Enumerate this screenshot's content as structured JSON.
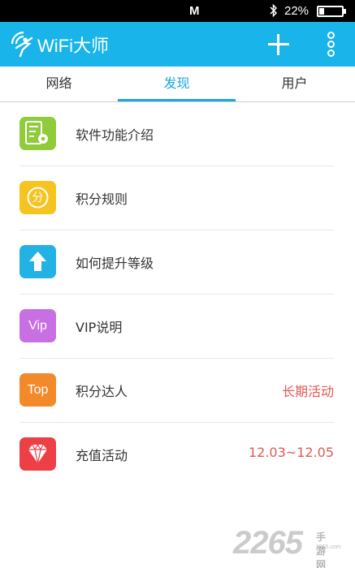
{
  "status_bar": {
    "carrier_icon": "M",
    "bluetooth_icon": "bluetooth-icon",
    "battery_text": "22%",
    "battery_level": 0.22
  },
  "app_bar": {
    "title": "WiFi大师",
    "logo_icon": "wifi-person-logo",
    "add_icon": "plus-icon",
    "more_icon": "more-vertical-icon",
    "background": "#19b4e9"
  },
  "tabs": [
    {
      "label": "网络",
      "active": false
    },
    {
      "label": "发现",
      "active": true
    },
    {
      "label": "用户",
      "active": false
    }
  ],
  "accent_color": "#19a7dc",
  "items": [
    {
      "label": "软件功能介绍",
      "icon": "settings-list-icon",
      "icon_color": "#8fcb3a",
      "icon_text": "",
      "extra": ""
    },
    {
      "label": "积分规则",
      "icon": "points-icon",
      "icon_color": "#f6c321",
      "icon_text": "分",
      "extra": ""
    },
    {
      "label": "如何提升等级",
      "icon": "arrow-up-icon",
      "icon_color": "#22b2e4",
      "icon_text": "",
      "extra": ""
    },
    {
      "label": "VIP说明",
      "icon": "vip-icon",
      "icon_color": "#c86fe3",
      "icon_text": "Vip",
      "extra": ""
    },
    {
      "label": "积分达人",
      "icon": "top-icon",
      "icon_color": "#f28a2a",
      "icon_text": "Top",
      "extra": "长期活动"
    },
    {
      "label": "充值活动",
      "icon": "diamond-icon",
      "icon_color": "#ec3f46",
      "icon_text": "",
      "extra": "12.03~12.05"
    }
  ],
  "extra_color": "#e05a52",
  "watermark": {
    "number": "2265",
    "tag": "手游网",
    "sub": "2265.com"
  }
}
